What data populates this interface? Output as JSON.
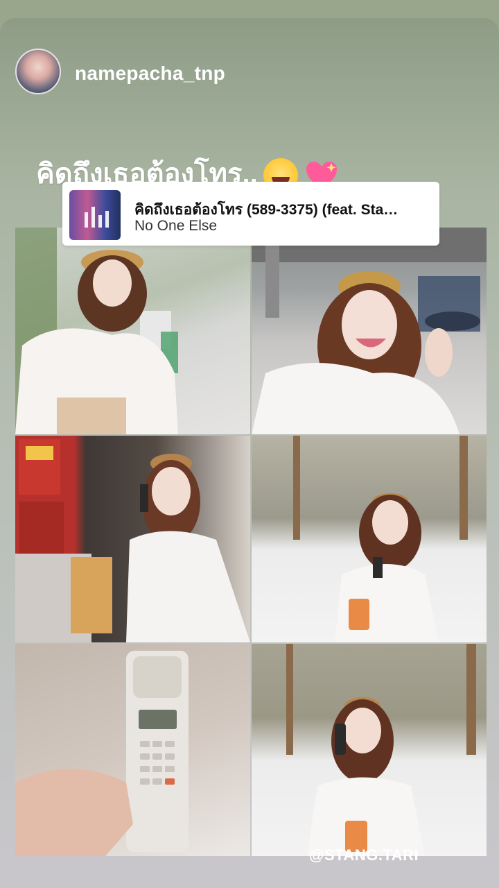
{
  "story": {
    "username": "namepacha_tnp",
    "caption": "คิดถึงเธอต้องโทร..",
    "emojis": [
      "laughing-emoji",
      "sparkling-heart-emoji"
    ],
    "music": {
      "title": "คิดถึงเธอต้องโทร (589-3375) (feat. Sta…",
      "artist": "No One Else"
    },
    "credit": "@STANG.TARI",
    "photos": [
      "photo-1",
      "photo-2",
      "photo-3",
      "photo-4",
      "photo-5",
      "photo-6"
    ]
  },
  "colors": {
    "background": "#9aa68c",
    "text": "#ffffff",
    "card": "#ffffff"
  }
}
